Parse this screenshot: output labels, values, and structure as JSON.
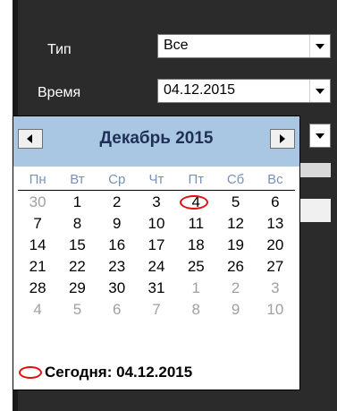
{
  "form": {
    "type_label": "Тип",
    "type_value": "Все",
    "time_label": "Время",
    "time_value": "04.12.2015"
  },
  "calendar": {
    "month_title": "Декабрь 2015",
    "weekdays": [
      "Пн",
      "Вт",
      "Ср",
      "Чт",
      "Пт",
      "Сб",
      "Вс"
    ],
    "weeks": [
      [
        "30",
        "1",
        "2",
        "3",
        "4",
        "5",
        "6"
      ],
      [
        "7",
        "8",
        "9",
        "10",
        "11",
        "12",
        "13"
      ],
      [
        "14",
        "15",
        "16",
        "17",
        "18",
        "19",
        "20"
      ],
      [
        "21",
        "22",
        "23",
        "24",
        "25",
        "26",
        "27"
      ],
      [
        "28",
        "29",
        "30",
        "31",
        "1",
        "2",
        "3"
      ],
      [
        "4",
        "5",
        "6",
        "7",
        "8",
        "9",
        "10"
      ]
    ],
    "selected_day": "4",
    "today_text": "Сегодня: 04.12.2015"
  },
  "colors": {
    "header": "#a9c6e2",
    "highlight": "#e21010",
    "weekday": "#7791ba"
  }
}
